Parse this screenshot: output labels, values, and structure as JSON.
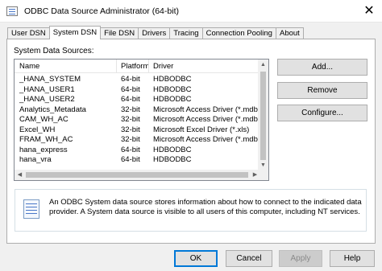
{
  "window": {
    "title": "ODBC Data Source Administrator (64-bit)",
    "close_glyph": "✕",
    "app_icon": "odbc-admin-icon"
  },
  "tabs": [
    {
      "label": "User DSN",
      "active": false
    },
    {
      "label": "System DSN",
      "active": true
    },
    {
      "label": "File DSN",
      "active": false
    },
    {
      "label": "Drivers",
      "active": false
    },
    {
      "label": "Tracing",
      "active": false
    },
    {
      "label": "Connection Pooling",
      "active": false
    },
    {
      "label": "About",
      "active": false
    }
  ],
  "system_dsn": {
    "section_label": "System Data Sources:",
    "columns": {
      "name": "Name",
      "platform": "Platform",
      "driver": "Driver"
    },
    "rows": [
      {
        "name": "_HANA_SYSTEM",
        "platform": "64-bit",
        "driver": "HDBODBC"
      },
      {
        "name": "_HANA_USER1",
        "platform": "64-bit",
        "driver": "HDBODBC"
      },
      {
        "name": "_HANA_USER2",
        "platform": "64-bit",
        "driver": "HDBODBC"
      },
      {
        "name": "Analytics_Metadata",
        "platform": "32-bit",
        "driver": "Microsoft Access Driver (*.mdb)"
      },
      {
        "name": "CAM_WH_AC",
        "platform": "32-bit",
        "driver": "Microsoft Access Driver (*.mdb)"
      },
      {
        "name": "Excel_WH",
        "platform": "32-bit",
        "driver": "Microsoft Excel Driver (*.xls)"
      },
      {
        "name": "FRAM_WH_AC",
        "platform": "32-bit",
        "driver": "Microsoft Access Driver (*.mdb)"
      },
      {
        "name": "hana_express",
        "platform": "64-bit",
        "driver": "HDBODBC"
      },
      {
        "name": "hana_vra",
        "platform": "64-bit",
        "driver": "HDBODBC"
      }
    ],
    "buttons": {
      "add": "Add...",
      "remove": "Remove",
      "configure": "Configure..."
    },
    "info_text": "An ODBC System data source stores information about how to connect to the indicated data provider. A System data source is visible to all users of this computer, including NT services.",
    "info_icon": "data-source-icon"
  },
  "footer": {
    "ok": "OK",
    "cancel": "Cancel",
    "apply": "Apply",
    "help": "Help"
  },
  "scroll_arrows": {
    "up": "▲",
    "down": "▼",
    "left": "◀",
    "right": "▶"
  }
}
